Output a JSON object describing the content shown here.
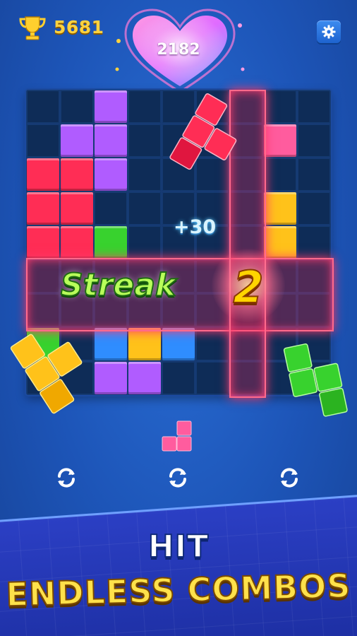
{
  "hud": {
    "best_score": "5681",
    "current_score": "2182"
  },
  "board": {
    "score_popup": "+30",
    "streak_label": "Streak",
    "streak_count": "2"
  },
  "banner": {
    "line1": "HIT",
    "line2": "ENDLESS COMBOS"
  },
  "icons": {
    "best": "trophy-icon",
    "settings": "gear-icon",
    "rotate": "refresh-icon"
  },
  "colors": {
    "background": "#1d55b8",
    "red": "#ff2d55",
    "purple": "#b05cff",
    "pink": "#ff5c9e",
    "yellow": "#ffc21a",
    "green": "#38d22e",
    "blue": "#2f8dff"
  }
}
